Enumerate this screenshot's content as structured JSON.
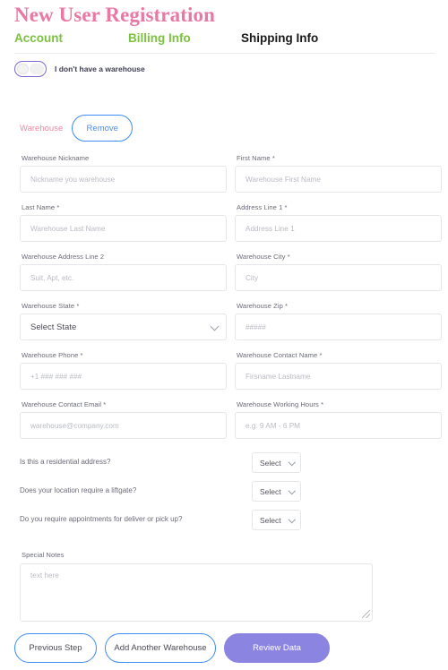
{
  "header": {
    "title": "New User Registration",
    "tabs": [
      {
        "label": "Account",
        "state": "complete"
      },
      {
        "label": "Billing Info",
        "state": "complete"
      },
      {
        "label": "Shipping Info",
        "state": "active"
      }
    ],
    "colors": {
      "title": "#e978a4",
      "tab_complete": "#7cc241",
      "tab_active": "#1a1a1a"
    }
  },
  "toggle": {
    "label": "I don't have a warehouse",
    "checked": false,
    "accent": "#7b68d9"
  },
  "warehouse_header": {
    "name": "Warehouse",
    "remove_label": "Remove",
    "name_color": "#ef8ba3",
    "remove_color": "#4a8ef0"
  },
  "fields": {
    "nickname": {
      "label": "Warehouse Nickname",
      "required": false,
      "value": "",
      "placeholder": "Nickname you warehouse"
    },
    "first_name": {
      "label": "First Name",
      "required": true,
      "value": "",
      "placeholder": "Warehouse First Name"
    },
    "last_name": {
      "label": "Last Name",
      "required": true,
      "value": "",
      "placeholder": "Warehouse Last Name"
    },
    "address1": {
      "label": "Address Line 1",
      "required": true,
      "value": "",
      "placeholder": "Address Line 1"
    },
    "address2": {
      "label": "Warehouse Address Line 2",
      "required": false,
      "value": "",
      "placeholder": "Suit, Apt, etc."
    },
    "city": {
      "label": "Warehouse City",
      "required": true,
      "value": "",
      "placeholder": "City"
    },
    "state": {
      "label": "Warehouse State",
      "required": true,
      "value": "Select State"
    },
    "zip": {
      "label": "Warehouse Zip",
      "required": true,
      "value": "",
      "placeholder": "#####"
    },
    "phone": {
      "label": "Warehouse Phone",
      "required": true,
      "value": "",
      "placeholder": "+1 ### ### ###"
    },
    "contact_name": {
      "label": "Warehouse Contact Name",
      "required": true,
      "value": "",
      "placeholder": "Firsname Lastname"
    },
    "contact_email": {
      "label": "Warehouse Contact Email",
      "required": true,
      "value": "",
      "placeholder": "warehouse@company.com"
    },
    "working_hours": {
      "label": "Warehouse Working Hours",
      "required": true,
      "value": "",
      "placeholder": "e.g. 9 AM - 6 PM"
    }
  },
  "questions": [
    {
      "text": "Is this a residential address?",
      "value": "Select"
    },
    {
      "text": "Does your location require a liftgate?",
      "value": "Select"
    },
    {
      "text": "Do you require appointments for deliver or pick up?",
      "value": "Select"
    }
  ],
  "notes": {
    "label": "Special Notes",
    "value": "",
    "placeholder": "text here"
  },
  "footer": {
    "previous_label": "Previous Step",
    "add_warehouse_label": "Add Another Warehouse",
    "review_label": "Review Data",
    "primary_color": "#8b84e0",
    "outline_color": "#3b8cf5"
  }
}
